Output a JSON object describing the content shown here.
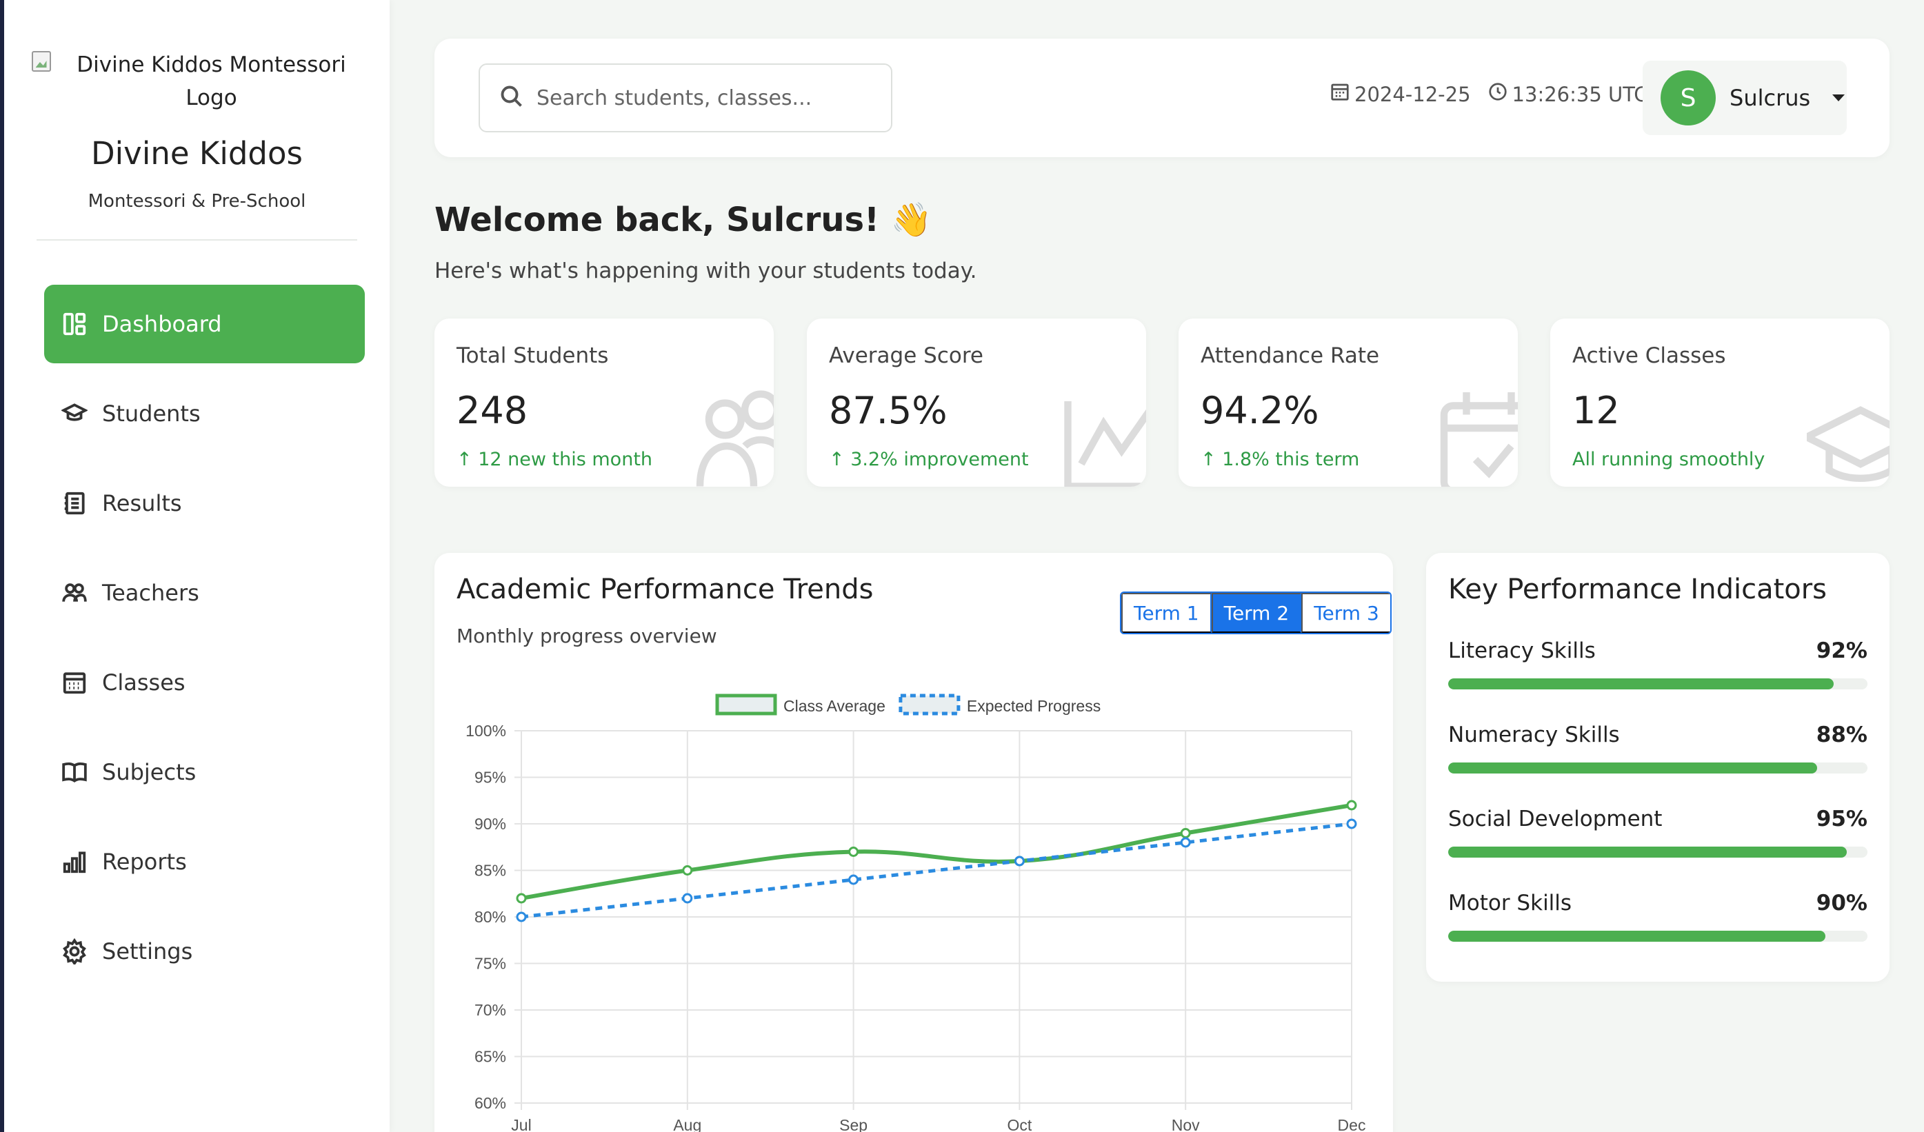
{
  "sidebar": {
    "logo_alt": "Divine Kiddos Montessori Logo",
    "brand_name": "Divine Kiddos",
    "brand_sub": "Montessori & Pre-School",
    "items": [
      {
        "label": "Dashboard",
        "icon": "dashboard-icon",
        "active": true
      },
      {
        "label": "Students",
        "icon": "graduation-cap-icon",
        "active": false
      },
      {
        "label": "Results",
        "icon": "journal-icon",
        "active": false
      },
      {
        "label": "Teachers",
        "icon": "people-icon",
        "active": false
      },
      {
        "label": "Classes",
        "icon": "calendar-grid-icon",
        "active": false
      },
      {
        "label": "Subjects",
        "icon": "book-icon",
        "active": false
      },
      {
        "label": "Reports",
        "icon": "bar-chart-icon",
        "active": false
      },
      {
        "label": "Settings",
        "icon": "gear-icon",
        "active": false
      }
    ]
  },
  "topbar": {
    "search_placeholder": "Search students, classes...",
    "date": "2024-12-25",
    "time": "13:26:35 UTC",
    "user_initial": "S",
    "user_name": "Sulcrus"
  },
  "welcome": {
    "title": "Welcome back, Sulcrus! 👋",
    "subtitle": "Here's what's happening with your students today."
  },
  "stats": [
    {
      "label": "Total Students",
      "value": "248",
      "delta": "↑ 12 new this month",
      "icon": "people-icon"
    },
    {
      "label": "Average Score",
      "value": "87.5%",
      "delta": "↑ 3.2% improvement",
      "icon": "line-graph-icon"
    },
    {
      "label": "Attendance Rate",
      "value": "94.2%",
      "delta": "↑ 1.8% this term",
      "icon": "calendar-check-icon"
    },
    {
      "label": "Active Classes",
      "value": "12",
      "delta": "All running smoothly",
      "icon": "graduation-cap-icon"
    }
  ],
  "performance": {
    "title": "Academic Performance Trends",
    "subtitle": "Monthly progress overview",
    "terms": [
      "Term 1",
      "Term 2",
      "Term 3"
    ],
    "active_term": "Term 2"
  },
  "chart_data": {
    "type": "line",
    "x": [
      "Jul",
      "Aug",
      "Sep",
      "Oct",
      "Nov",
      "Dec"
    ],
    "series": [
      {
        "name": "Class Average",
        "values": [
          82,
          85,
          87,
          86,
          89,
          92
        ],
        "color": "#4caf50",
        "style": "solid"
      },
      {
        "name": "Expected Progress",
        "values": [
          80,
          82,
          84,
          86,
          88,
          90
        ],
        "color": "#2b8be0",
        "style": "dashed"
      }
    ],
    "ylim": [
      60,
      100
    ],
    "yticks": [
      "100%",
      "95%",
      "90%",
      "85%",
      "80%",
      "75%",
      "70%",
      "65%",
      "60%"
    ],
    "grid": true,
    "legend": "top-center"
  },
  "kpi": {
    "title": "Key Performance Indicators",
    "items": [
      {
        "label": "Literacy Skills",
        "pct": "92%",
        "value": 92
      },
      {
        "label": "Numeracy Skills",
        "pct": "88%",
        "value": 88
      },
      {
        "label": "Social Development",
        "pct": "95%",
        "value": 95
      },
      {
        "label": "Motor Skills",
        "pct": "90%",
        "value": 90
      }
    ]
  },
  "colors": {
    "accent": "#4caf50",
    "delta_green": "#2e9b45",
    "term_blue": "#1a73e8"
  }
}
